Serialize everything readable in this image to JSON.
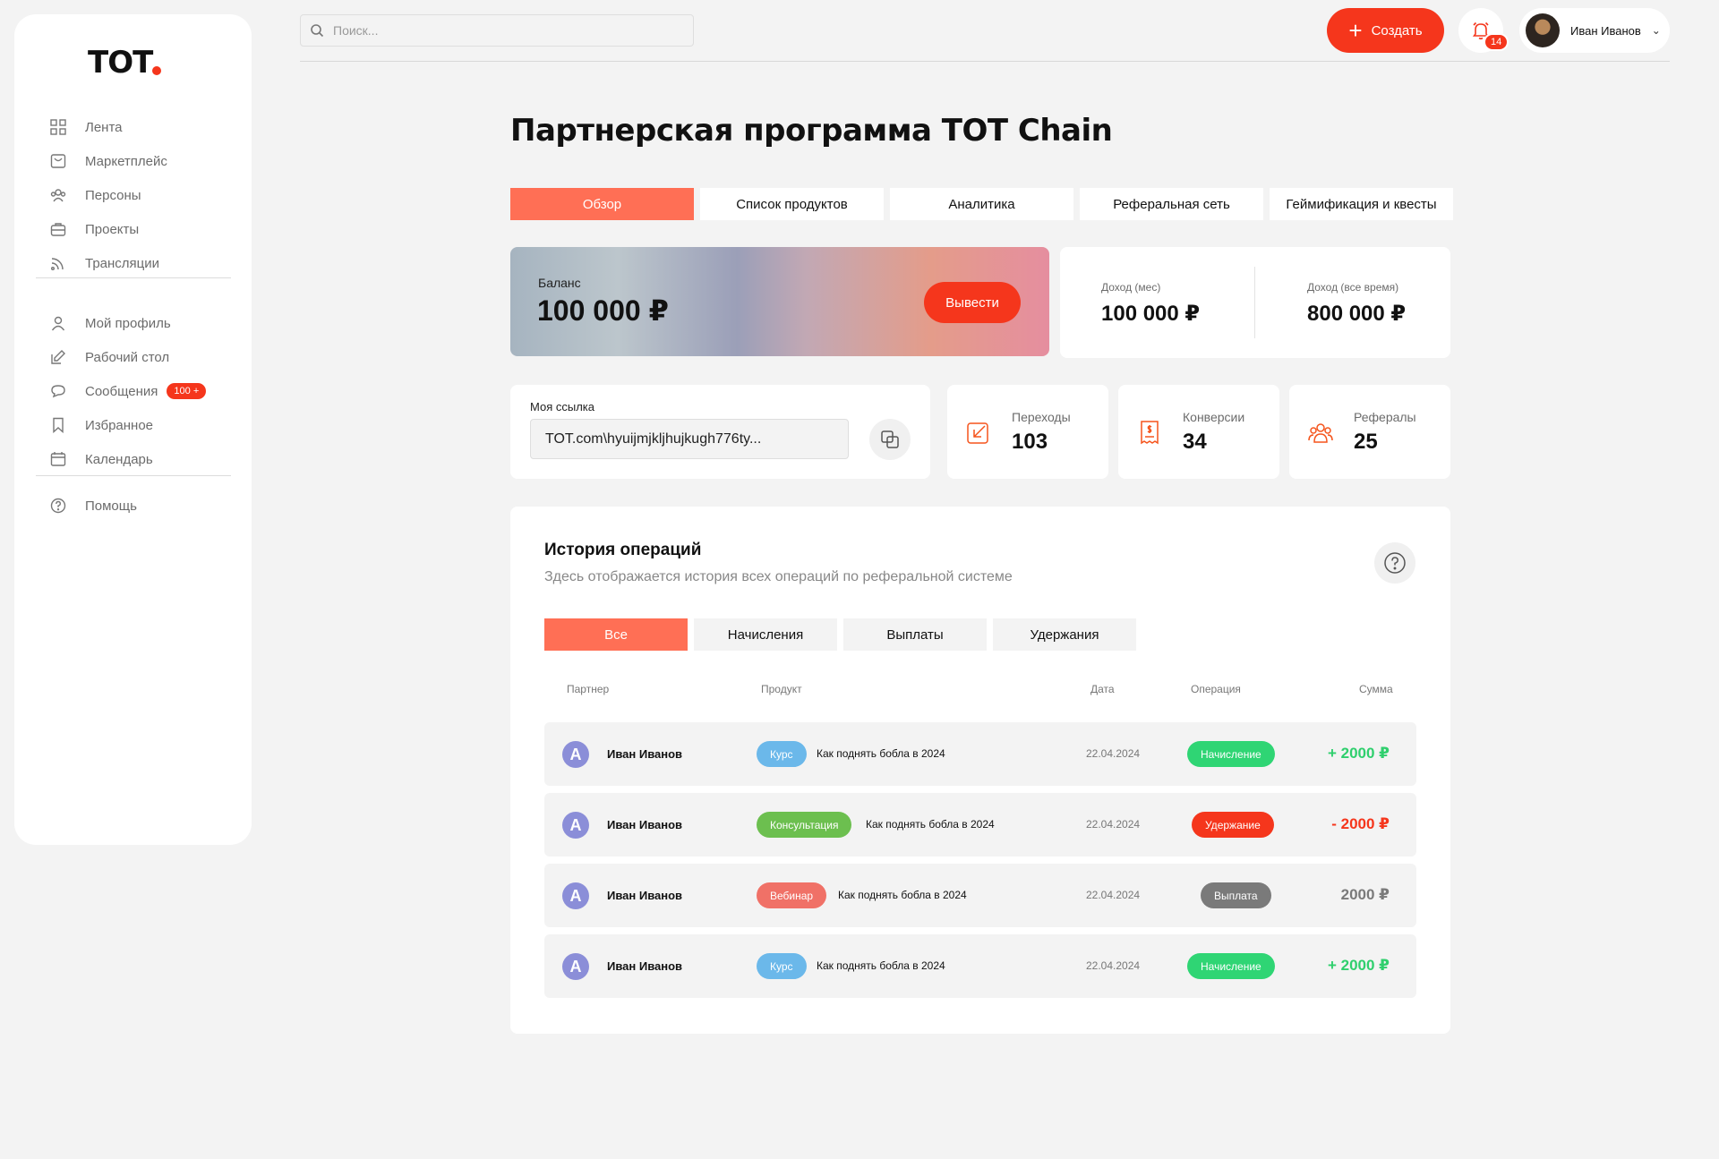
{
  "logo": "TOT",
  "sidebar": {
    "items": [
      {
        "label": "Лента",
        "icon": "grid-icon"
      },
      {
        "label": "Маркетплейс",
        "icon": "shopping-bag-icon"
      },
      {
        "label": "Персоны",
        "icon": "users-icon"
      },
      {
        "label": "Проекты",
        "icon": "briefcase-icon"
      },
      {
        "label": "Трансляции",
        "icon": "broadcast-icon"
      }
    ],
    "items2": [
      {
        "label": "Мой профиль",
        "icon": "user-icon"
      },
      {
        "label": "Рабочий стол",
        "icon": "edit-icon"
      },
      {
        "label": "Сообщения",
        "icon": "chat-icon",
        "badge": "100 +"
      },
      {
        "label": "Избранное",
        "icon": "bookmark-icon"
      },
      {
        "label": "Календарь",
        "icon": "calendar-icon"
      }
    ],
    "items3": [
      {
        "label": "Помощь",
        "icon": "help-icon"
      }
    ]
  },
  "header": {
    "search_placeholder": "Поиск...",
    "create_label": "Создать",
    "notifications_count": "14",
    "user_name": "Иван Иванов"
  },
  "main": {
    "title": "Партнерская программа TOT Chain",
    "tabs": [
      "Обзор",
      "Список продуктов",
      "Аналитика",
      "Реферальная сеть",
      "Геймификация и квесты"
    ],
    "balance": {
      "label": "Баланс",
      "value": "100 000 ₽",
      "withdraw_label": "Вывести"
    },
    "income": {
      "month_label": "Доход (мес)",
      "month_value": "100 000 ₽",
      "all_label": "Доход (все время)",
      "all_value": "800 000 ₽"
    },
    "link": {
      "label": "Моя ссылка",
      "value": "TOT.com\\hyuijmjkljhujkugh776ty..."
    },
    "stats": [
      {
        "label": "Переходы",
        "value": "103",
        "icon": "arrow-in-icon"
      },
      {
        "label": "Конверсии",
        "value": "34",
        "icon": "receipt-icon"
      },
      {
        "label": "Рефералы",
        "value": "25",
        "icon": "people-icon"
      }
    ],
    "history": {
      "title": "История операций",
      "subtitle": "Здесь отображается история всех операций по реферальной системе",
      "filters": [
        "Все",
        "Начисления",
        "Выплаты",
        "Удержания"
      ],
      "columns": [
        "Партнер",
        "Продукт",
        "Дата",
        "Операция",
        "Сумма"
      ],
      "rows": [
        {
          "avatar": "A",
          "partner": "Иван Иванов",
          "type": "Курс",
          "type_color": "#6bb8ea",
          "product": "Как поднять бобла в 2024",
          "date": "22.04.2024",
          "operation": "Начисление",
          "op_color": "#2fd574",
          "amount": "+ 2000 ₽",
          "amount_color": "#2fcf6d"
        },
        {
          "avatar": "A",
          "partner": "Иван Иванов",
          "type": "Консультация",
          "type_color": "#6cbf4f",
          "product": "Как поднять бобла в 2024",
          "date": "22.04.2024",
          "operation": "Удержание",
          "op_color": "#f5361c",
          "amount": "- 2000 ₽",
          "amount_color": "#f5361c"
        },
        {
          "avatar": "A",
          "partner": "Иван Иванов",
          "type": "Вебинар",
          "type_color": "#f07167",
          "product": "Как поднять бобла в 2024",
          "date": "22.04.2024",
          "operation": "Выплата",
          "op_color": "#7a7a7a",
          "amount": "2000 ₽",
          "amount_color": "#7a7a7a"
        },
        {
          "avatar": "A",
          "partner": "Иван Иванов",
          "type": "Курс",
          "type_color": "#6bb8ea",
          "product": "Как поднять бобла в 2024",
          "date": "22.04.2024",
          "operation": "Начисление",
          "op_color": "#2fd574",
          "amount": "+ 2000 ₽",
          "amount_color": "#2fcf6d"
        }
      ]
    }
  }
}
